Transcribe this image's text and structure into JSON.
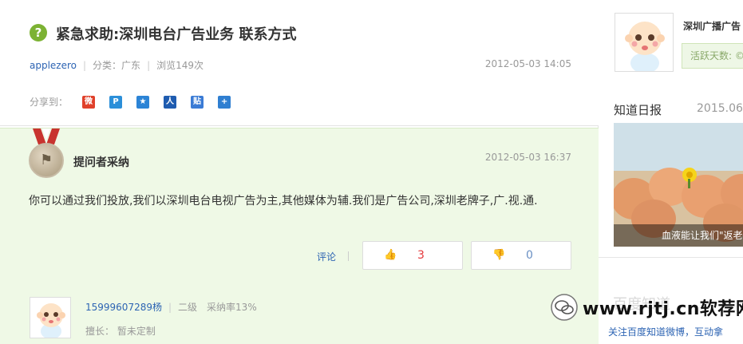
{
  "question": {
    "icon": "question-icon",
    "title": "紧急求助:深圳电台广告业务 联系方式",
    "user": "applezero",
    "category": "分类：广东",
    "views": "浏览149次",
    "date": "2012-05-03 14:05",
    "share_label": "分享到：",
    "share_icons": [
      "sina-weibo-icon",
      "qq-space-icon",
      "qzone-icon",
      "renren-icon",
      "tieba-icon",
      "more-share-icon"
    ]
  },
  "best_answer": {
    "label": "提问者采纳",
    "date": "2012-05-03 16:37",
    "text": "你可以通过我们投放,我们以深圳电台电视广告为主,其他媒体为辅.我们是广告公司,深圳老牌子,广.视.通.",
    "comment_label": "评论",
    "upvotes": "3",
    "downvotes": "0"
  },
  "answerer": {
    "name": "15999607289杨",
    "level": "二级",
    "adopt_rate": "采纳率13%",
    "skill": "擅长：  暂未定制"
  },
  "sidebar": {
    "user_name": "深圳广播广告",
    "active_days": "活跃天数: ©",
    "ribao_title": "知道日报",
    "ribao_date": "2015.06.",
    "photo_caption": "血液能让我们\"返老",
    "faint_text": "百度知道",
    "link": "关注百度知道微博，互动拿"
  },
  "watermark": {
    "text": "www.rjtj.cn软荐网"
  },
  "colors": {
    "accent_green": "#7cb233",
    "link_blue": "#2d64b3",
    "answer_bg": "#eff9e6",
    "vote_red": "#e4393c"
  }
}
